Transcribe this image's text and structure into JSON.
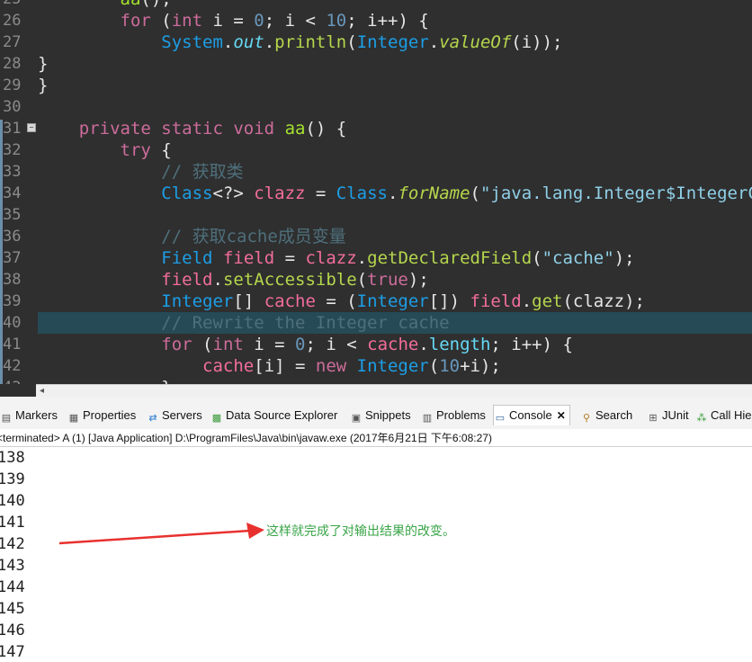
{
  "editor": {
    "line_numbers": [
      "25",
      "26",
      "27",
      "28",
      "29",
      "30",
      "31",
      "32",
      "33",
      "34",
      "35",
      "36",
      "37",
      "38",
      "39",
      "40",
      "41",
      "42",
      "43"
    ],
    "code": {
      "l25": {
        "name": "aa",
        "rest": "();"
      },
      "l26": {
        "kw_for": "for",
        "p1": " (",
        "kw_int": "int",
        "p2": " i = ",
        "n0": "0",
        "p3": "; i < ",
        "n10": "10",
        "p4": "; i++) {"
      },
      "l27": {
        "system": "System",
        "dot1": ".",
        "out": "out",
        "dot2": ".",
        "println": "println",
        "p1": "(",
        "integer": "Integer",
        "dot3": ".",
        "valueof": "valueOf",
        "p2": "(i));"
      },
      "l28": "}",
      "l29": "}",
      "l31": {
        "kw_private": "private",
        "kw_static": " static",
        "kw_void": " void",
        "name": " aa",
        "rest": "() {"
      },
      "l32": {
        "kw_try": "try",
        "rest": " {"
      },
      "l33": "// 获取类",
      "l34": {
        "class1": "Class",
        "g": "<?> ",
        "clazz": "clazz",
        "eq": " = ",
        "class2": "Class",
        "dot": ".",
        "forname": "forName",
        "p": "(",
        "str": "\"java.lang.Integer$IntegerCache\""
      },
      "l36": "// 获取cache成员变量",
      "l37": {
        "field_t": "Field",
        "sp": " ",
        "field_v": "field",
        "eq": " = ",
        "clazz": "clazz",
        "dot": ".",
        "m": "getDeclaredField",
        "p1": "(",
        "str": "\"cache\"",
        "p2": ");"
      },
      "l38": {
        "field_v": "field",
        "dot": ".",
        "m": "setAccessible",
        "p1": "(",
        "lit": "true",
        "p2": ");"
      },
      "l39": {
        "t1": "Integer",
        "b1": "[] ",
        "cache": "cache",
        "eq": " = (",
        "t2": "Integer",
        "b2": "[]) ",
        "field_v": "field",
        "dot": ".",
        "m": "get",
        "p": "(clazz);"
      },
      "l40": "// Rewrite the Integer cache",
      "l41": {
        "kw_for": "for",
        "p1": " (",
        "kw_int": "int",
        "p2": " i = ",
        "n0": "0",
        "p3": "; i < ",
        "cache": "cache",
        "dot": ".",
        "len": "length",
        "p4": "; i++) {"
      },
      "l42": {
        "cache": "cache",
        "idx": "[i] = ",
        "kw_new": "new",
        "sp": " ",
        "t": "Integer",
        "p1": "(",
        "n10": "10",
        "p2": "+i);"
      },
      "l43": "}"
    }
  },
  "views": {
    "tabs": [
      {
        "label": "Markers",
        "icon": "markers-icon"
      },
      {
        "label": "Properties",
        "icon": "properties-icon"
      },
      {
        "label": "Servers",
        "icon": "servers-icon"
      },
      {
        "label": "Data Source Explorer",
        "icon": "data-source-icon"
      },
      {
        "label": "Snippets",
        "icon": "snippets-icon"
      },
      {
        "label": "Problems",
        "icon": "problems-icon"
      },
      {
        "label": "Console",
        "icon": "console-icon",
        "active": true
      },
      {
        "label": "Search",
        "icon": "search-icon"
      },
      {
        "label": "JUnit",
        "icon": "junit-icon"
      },
      {
        "label": "Call Hie",
        "icon": "call-hierarchy-icon"
      }
    ]
  },
  "status": "<terminated> A (1) [Java Application] D:\\ProgramFiles\\Java\\bin\\javaw.exe (2017年6月21日 下午6:08:27)",
  "console": {
    "lines": [
      "138",
      "139",
      "140",
      "141",
      "142",
      "143",
      "144",
      "145",
      "146",
      "147"
    ]
  },
  "annotation": {
    "text": "这样就完成了对输出结果的改变。",
    "color": "#39a548",
    "arrow_color": "#e8312f"
  },
  "colors": {
    "editor_bg": "#2f2f2f",
    "keyword": "#cc6c9b",
    "type": "#1f9ce0",
    "comment": "#4e6f7b",
    "highlight_line": "#264b57"
  }
}
